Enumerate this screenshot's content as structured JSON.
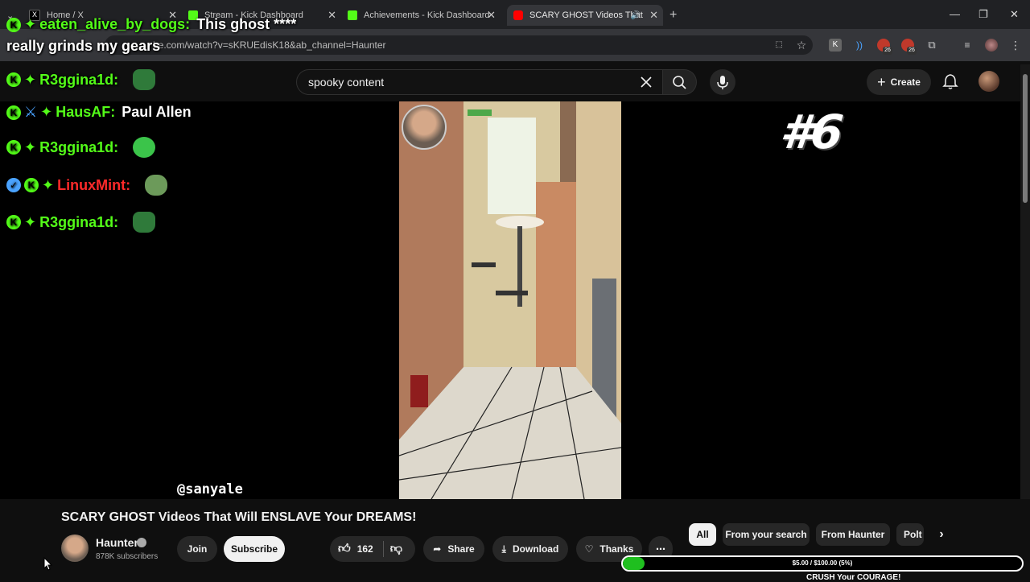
{
  "browser": {
    "tabs": [
      {
        "title": "Home / X"
      },
      {
        "title": "Stream - Kick Dashboard"
      },
      {
        "title": "Achievements - Kick Dashboard"
      },
      {
        "title": "SCARY GHOST Videos That"
      }
    ],
    "url": "be.com/watch?v=sKRUEdisK18&ab_channel=Haunter",
    "extension_badges": [
      "26",
      "26"
    ]
  },
  "youtube": {
    "search": {
      "value": "spooky content"
    },
    "create_label": "Create",
    "video": {
      "episode_number": "#6",
      "watermark": "@sanyale",
      "title": "SCARY GHOST Videos That Will ENSLAVE Your DREAMS!"
    },
    "channel": {
      "name": "Haunter",
      "subscribers": "878K subscribers"
    },
    "actions": {
      "join": "Join",
      "subscribe": "Subscribe",
      "likes": "162",
      "share": "Share",
      "download": "Download",
      "thanks": "Thanks"
    },
    "chips": [
      "All",
      "From your search",
      "From Haunter",
      "Polt"
    ]
  },
  "chat_overlay": {
    "messages": [
      {
        "user": "eaten_alive_by_dogs:",
        "text": "This ghost ****"
      },
      {
        "user": "",
        "text": "really grinds my gears"
      },
      {
        "user": "R3ggina1d:",
        "text": ""
      },
      {
        "user": "HausAF:",
        "text": "Paul Allen"
      },
      {
        "user": "R3ggina1d:",
        "text": ""
      },
      {
        "user": "LinuxMint:",
        "text": ""
      },
      {
        "user": "R3ggina1d:",
        "text": ""
      }
    ]
  },
  "donation_goal": {
    "text": "$5.00 / $100.00 (5%)",
    "progress": 0.05,
    "caption": "CRUSH Your COURAGE!"
  },
  "colors": {
    "kick_green": "#53fc18",
    "linuxmint_red": "#ff2a2a",
    "goal_fill": "#1fbf1f"
  }
}
